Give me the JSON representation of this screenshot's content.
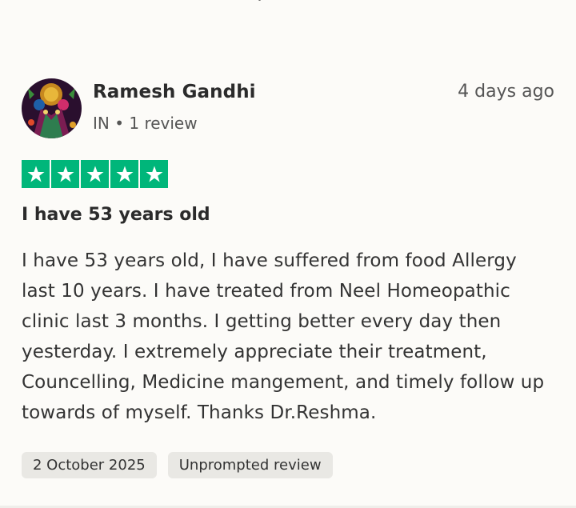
{
  "review": {
    "reviewer_name": "Ramesh Gandhi",
    "reviewer_meta": "IN • 1 review",
    "date_ago": "4 days ago",
    "rating": 5,
    "rating_max": 5,
    "star_color": "#00b67a",
    "title": "I have 53 years old",
    "body": "I have 53 years old, I have suffered from food Allergy last 10 years. I have treated from Neel Homeopathic clinic last 3 months. I getting better every day then yesterday. I extremely appreciate their treatment, Councelling, Medicine mangement, and timely follow up towards of myself. Thanks Dr.Reshma.",
    "date_of_experience": "2 October 2025",
    "tag": "Unprompted review"
  }
}
